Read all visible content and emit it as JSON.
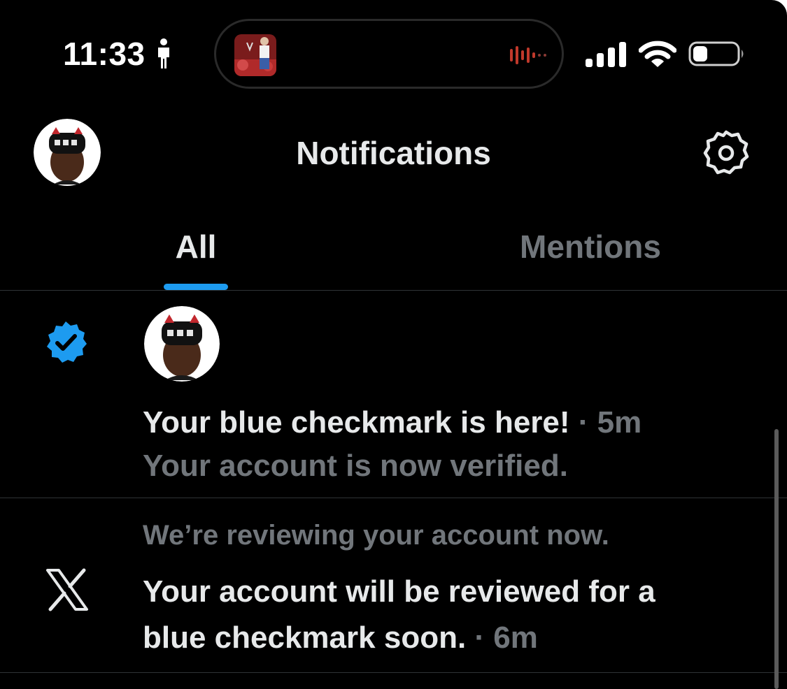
{
  "status_bar": {
    "time": "11:33",
    "battery_level": 0.25
  },
  "header": {
    "title": "Notifications"
  },
  "tabs": [
    {
      "label": "All",
      "active": true
    },
    {
      "label": "Mentions",
      "active": false
    }
  ],
  "notifications": [
    {
      "icon": "verified-badge-icon",
      "title": "Your blue checkmark is here!",
      "separator": " · ",
      "time": "5m",
      "body": "Your account is now verified."
    },
    {
      "icon": "x-logo-icon",
      "preview": "We’re reviewing your account now.",
      "title_line1": "Your account will be reviewed for a",
      "title_line2": "blue checkmark soon.",
      "separator": " · ",
      "time": "6m"
    }
  ],
  "colors": {
    "background": "#000000",
    "text_primary": "#e7e9ea",
    "text_secondary": "#71767b",
    "accent": "#1d9bf0",
    "divider": "#2f3336"
  }
}
